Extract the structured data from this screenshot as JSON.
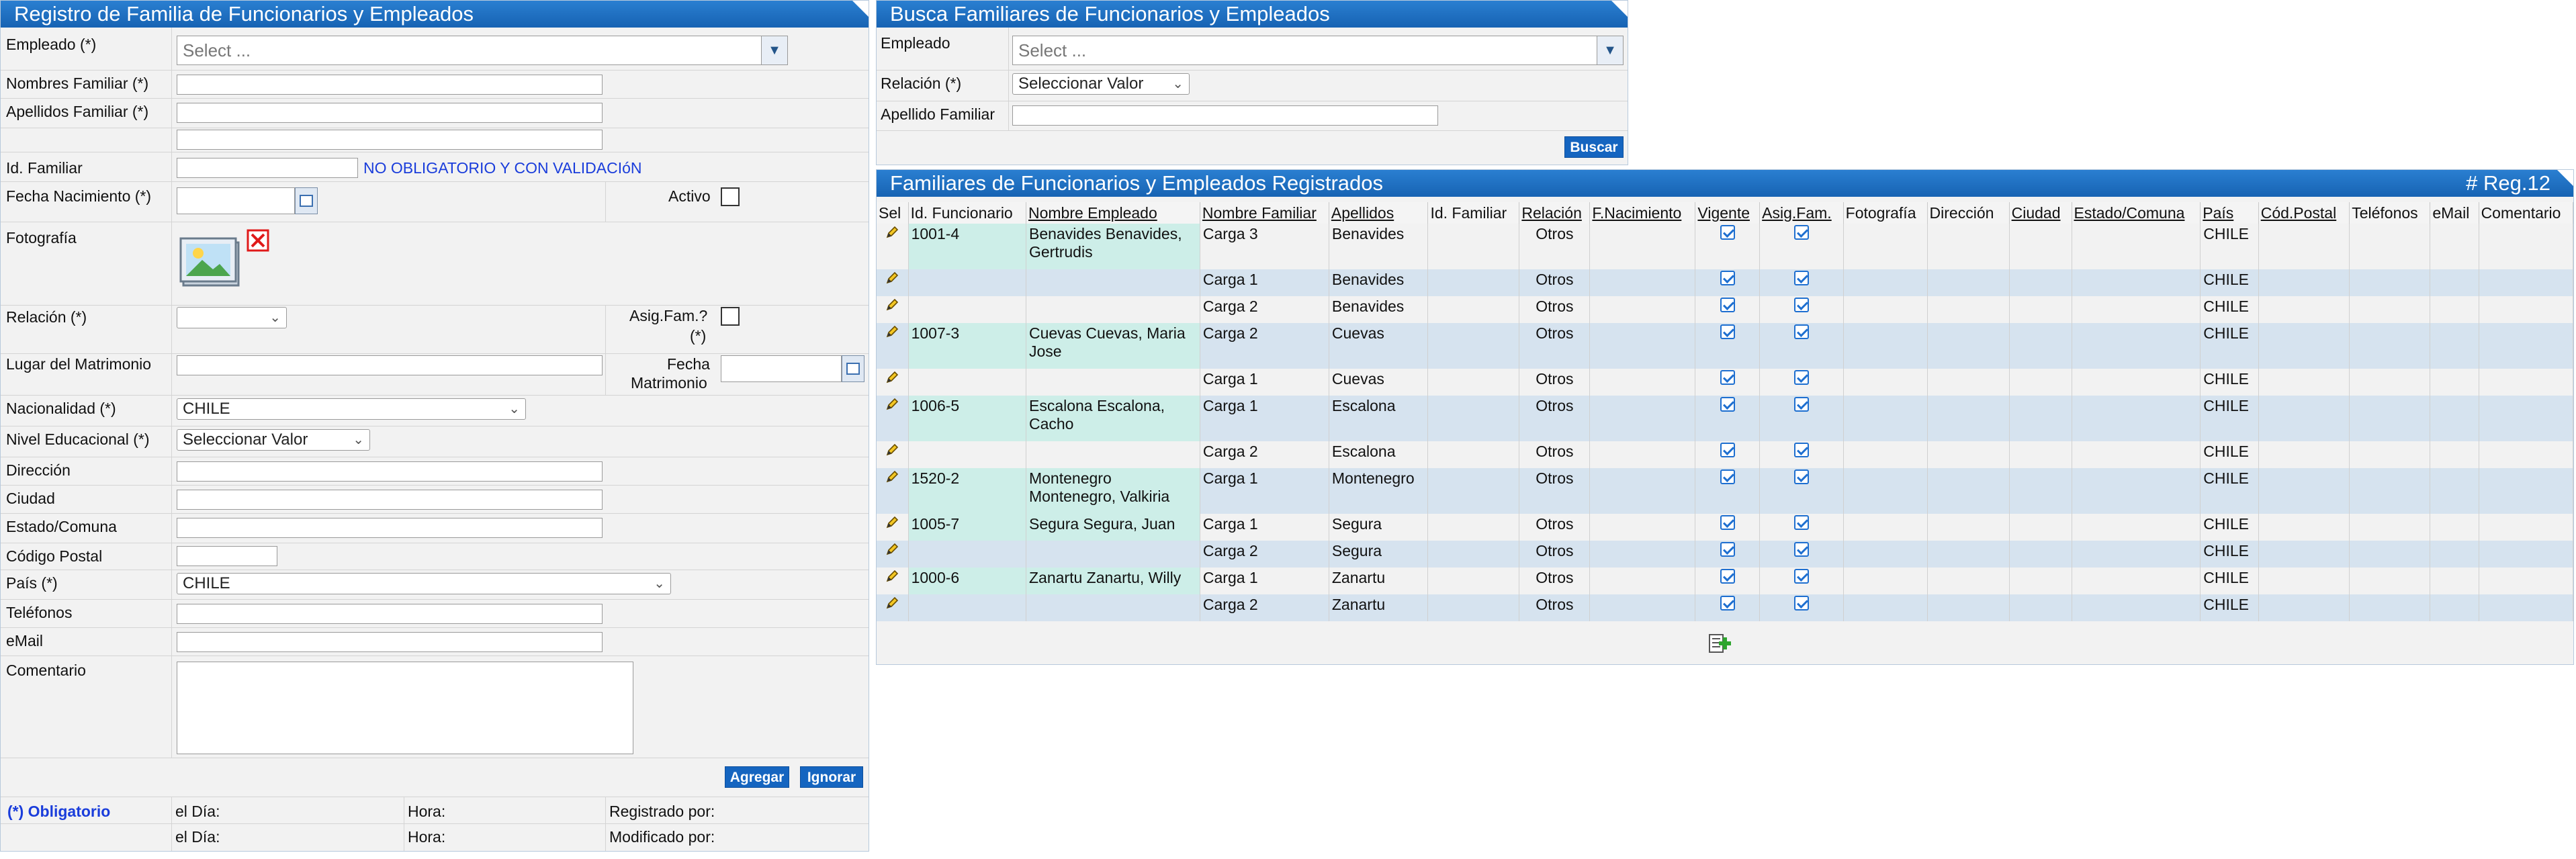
{
  "left_panel": {
    "title": "Registro de Familia de Funcionarios y Empleados",
    "fields": {
      "empleado_label": "Empleado (*)",
      "empleado_placeholder": "Select ...",
      "nombres_label": "Nombres Familiar (*)",
      "apellidos_label": "Apellidos Familiar (*)",
      "id_label": "Id. Familiar",
      "id_note": "NO OBLIGATORIO Y CON VALIDACIóN",
      "fecha_nac_label": "Fecha Nacimiento (*)",
      "activo_label": "Activo",
      "fotografia_label": "Fotografía",
      "relacion_label": "Relación (*)",
      "asig_label_1": "Asig.Fam.?",
      "asig_label_2": "(*)",
      "lugar_label": "Lugar del Matrimonio",
      "fecha_mat_label_1": "Fecha",
      "fecha_mat_label_2": "Matrimonio",
      "nacionalidad_label": "Nacionalidad (*)",
      "nacionalidad_value": "CHILE",
      "nivel_label": "Nivel Educacional (*)",
      "nivel_value": "Seleccionar Valor",
      "direccion_label": "Dirección",
      "ciudad_label": "Ciudad",
      "estado_label": "Estado/Comuna",
      "codigo_label": "Código Postal",
      "pais_label": "País (*)",
      "pais_value": "CHILE",
      "telefonos_label": "Teléfonos",
      "email_label": "eMail",
      "comentario_label": "Comentario"
    },
    "buttons": {
      "agregar": "Agregar",
      "ignorar": "Ignorar"
    },
    "footer": {
      "obligatorio": "(*) Obligatorio",
      "el_dia": "el Día:",
      "hora": "Hora:",
      "registrado": "Registrado por:",
      "modificado": "Modificado por:"
    }
  },
  "search_panel": {
    "title": "Busca Familiares de Funcionarios y Empleados",
    "empleado_label": "Empleado",
    "empleado_placeholder": "Select ...",
    "relacion_label": "Relación (*)",
    "relacion_value": "Seleccionar Valor",
    "apellido_label": "Apellido Familiar",
    "buscar": "Buscar"
  },
  "results_panel": {
    "title": "Familiares de Funcionarios y Empleados Registrados",
    "count": "# Reg.12",
    "columns": [
      "Sel",
      "Id. Funcionario",
      "Nombre Empleado",
      "Nombre Familiar",
      "Apellidos",
      "Id. Familiar",
      "Relación",
      "F.Nacimiento",
      "Vigente",
      "Asig.Fam.",
      "Fotografía",
      "Dirección",
      "Ciudad",
      "Estado/Comuna",
      "País",
      "Cód.Postal",
      "Teléfonos",
      "eMail",
      "Comentario"
    ],
    "rows": [
      {
        "id": "1001-4",
        "emp": "Benavides Benavides, Gertrudis",
        "fam": "Carga 3",
        "ape": "Benavides",
        "rel": "Otros",
        "pais": "CHILE"
      },
      {
        "id": "",
        "emp": "",
        "fam": "Carga 1",
        "ape": "Benavides",
        "rel": "Otros",
        "pais": "CHILE"
      },
      {
        "id": "",
        "emp": "",
        "fam": "Carga 2",
        "ape": "Benavides",
        "rel": "Otros",
        "pais": "CHILE"
      },
      {
        "id": "1007-3",
        "emp": "Cuevas Cuevas, Maria Jose",
        "fam": "Carga 2",
        "ape": "Cuevas",
        "rel": "Otros",
        "pais": "CHILE"
      },
      {
        "id": "",
        "emp": "",
        "fam": "Carga 1",
        "ape": "Cuevas",
        "rel": "Otros",
        "pais": "CHILE"
      },
      {
        "id": "1006-5",
        "emp": "Escalona Escalona, Cacho",
        "fam": "Carga 1",
        "ape": "Escalona",
        "rel": "Otros",
        "pais": "CHILE"
      },
      {
        "id": "",
        "emp": "",
        "fam": "Carga 2",
        "ape": "Escalona",
        "rel": "Otros",
        "pais": "CHILE"
      },
      {
        "id": "1520-2",
        "emp": "Montenegro Montenegro, Valkiria",
        "fam": "Carga 1",
        "ape": "Montenegro",
        "rel": "Otros",
        "pais": "CHILE"
      },
      {
        "id": "1005-7",
        "emp": "Segura Segura, Juan",
        "fam": "Carga 1",
        "ape": "Segura",
        "rel": "Otros",
        "pais": "CHILE"
      },
      {
        "id": "",
        "emp": "",
        "fam": "Carga 2",
        "ape": "Segura",
        "rel": "Otros",
        "pais": "CHILE"
      },
      {
        "id": "1000-6",
        "emp": "Zanartu Zanartu, Willy",
        "fam": "Carga 1",
        "ape": "Zanartu",
        "rel": "Otros",
        "pais": "CHILE"
      },
      {
        "id": "",
        "emp": "",
        "fam": "Carga 2",
        "ape": "Zanartu",
        "rel": "Otros",
        "pais": "CHILE"
      }
    ]
  }
}
